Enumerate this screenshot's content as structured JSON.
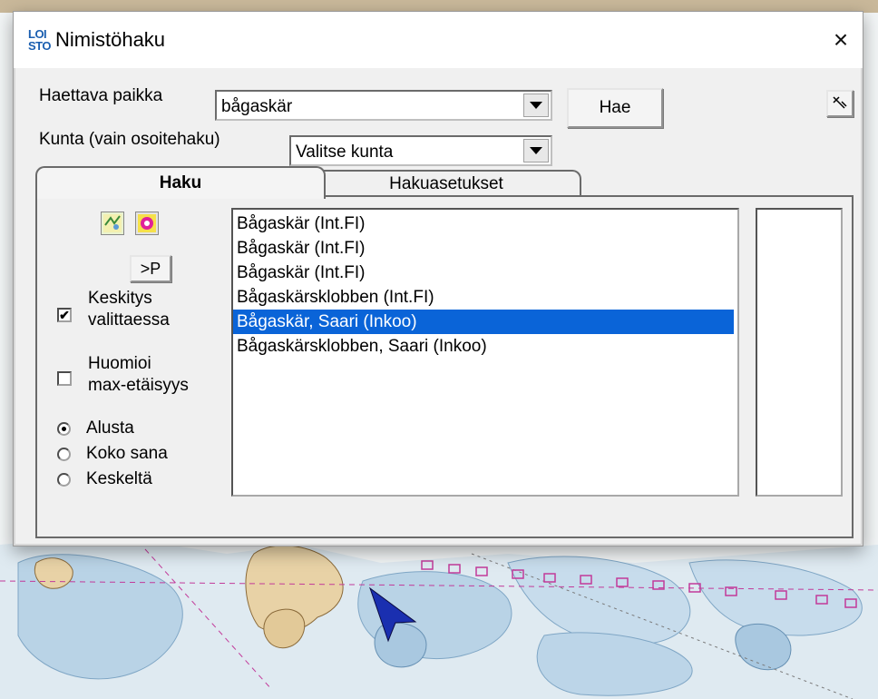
{
  "window": {
    "logo_top": "LOI",
    "logo_bottom": "STO",
    "title": "Nimistöhaku",
    "close_icon": "×"
  },
  "search": {
    "place_label": "Haettava paikka",
    "place_value": "bågaskär",
    "search_button": "Hae",
    "municipality_label": "Kunta (vain osoitehaku)",
    "municipality_value": "Valitse kunta"
  },
  "tabs": [
    {
      "label": "Haku",
      "active": true
    },
    {
      "label": "Hakuasetukset",
      "active": false
    }
  ],
  "options": {
    "next_button": ">P",
    "center_label_line1": "Keskitys",
    "center_label_line2": "valittaessa",
    "center_checked": true,
    "maxdist_label_line1": "Huomioi",
    "maxdist_label_line2": "max-etäisyys",
    "maxdist_checked": false,
    "match_modes": [
      {
        "label": "Alusta",
        "selected": true
      },
      {
        "label": "Koko sana",
        "selected": false
      },
      {
        "label": "Keskeltä",
        "selected": false
      }
    ]
  },
  "results": [
    {
      "text": "Bågaskär (Int.FI)",
      "selected": false
    },
    {
      "text": "Bågaskär (Int.FI)",
      "selected": false
    },
    {
      "text": "Bågaskär (Int.FI)",
      "selected": false
    },
    {
      "text": "Bågaskärsklobben (Int.FI)",
      "selected": false
    },
    {
      "text": "Bågaskär, Saari (Inkoo)",
      "selected": true
    },
    {
      "text": "Bågaskärsklobben, Saari (Inkoo)",
      "selected": false
    }
  ],
  "icons": {
    "pick": "pointer-pick-icon",
    "map_tool": "map-tool-icon",
    "flower_tool": "marker-tool-icon",
    "dropdown": "chevron-down-icon"
  },
  "colors": {
    "selection": "#0a64d8",
    "logo": "#1b5fb0"
  }
}
